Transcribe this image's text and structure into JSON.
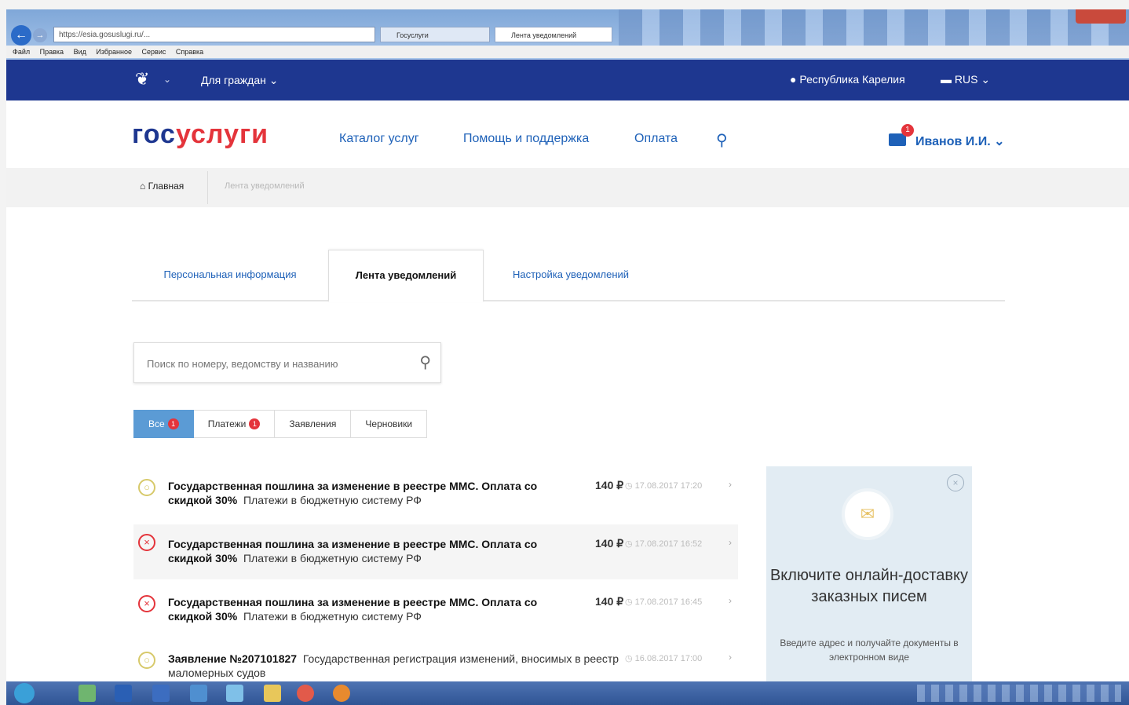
{
  "browser": {
    "address": "https://esia.gosuslugi.ru/...",
    "tabs": [
      "Госуслуги",
      "Лента уведомлений"
    ],
    "menu": [
      "Файл",
      "Правка",
      "Вид",
      "Избранное",
      "Сервис",
      "Справка"
    ]
  },
  "topbar": {
    "emblem_icon": "coat-of-arms-icon",
    "for_citizens": "Для граждан ⌄",
    "region": "Республика Карелия",
    "lang": "RUS ⌄"
  },
  "header": {
    "logo_part1": "гос",
    "logo_part2": "услуги",
    "nav": [
      "Каталог услуг",
      "Помощь и поддержка",
      "Оплата"
    ],
    "mail_badge": "1",
    "user": "Иванов И.И."
  },
  "breadcrumb": {
    "home": "Главная",
    "current": "Лента уведомлений"
  },
  "tabs": [
    {
      "label": "Персональная информация",
      "active": false
    },
    {
      "label": "Лента уведомлений",
      "active": true
    },
    {
      "label": "Настройка уведомлений",
      "active": false
    }
  ],
  "search": {
    "placeholder": "Поиск по номеру, ведомству и названию"
  },
  "filters": [
    {
      "label": "Все",
      "badge": "1",
      "active": true
    },
    {
      "label": "Платежи",
      "badge": "1",
      "active": false
    },
    {
      "label": "Заявления",
      "badge": "",
      "active": false
    },
    {
      "label": "Черновики",
      "badge": "",
      "active": false
    }
  ],
  "feed": [
    {
      "status": "pending",
      "title": "Государственная пошлина за изменение в реестре ММС. Оплата со скидкой 30%",
      "subtitle": "Платежи в бюджетную систему РФ",
      "amount": "140 ₽",
      "date": "17.08.2017 17:20"
    },
    {
      "status": "error",
      "title": "Государственная пошлина за изменение в реестре ММС. Оплата со скидкой 30%",
      "subtitle": "Платежи в бюджетную систему РФ",
      "amount": "140 ₽",
      "date": "17.08.2017 16:52"
    },
    {
      "status": "error",
      "title": "Государственная пошлина за изменение в реестре ММС. Оплата со скидкой 30%",
      "subtitle": "Платежи в бюджетную систему РФ",
      "amount": "140 ₽",
      "date": "17.08.2017 16:45"
    },
    {
      "status": "pending",
      "title": "Заявление №207101827",
      "subtitle": "Государственная регистрация изменений, вносимых в реестр маломерных судов",
      "amount": "",
      "date": "16.08.2017 17:00"
    }
  ],
  "promo": {
    "title": "Включите онлайн-доставку заказных писем",
    "text": "Введите адрес и получайте документы в электронном виде"
  },
  "colors": {
    "brand_blue": "#1e3790",
    "link_blue": "#1e61b8",
    "brand_red": "#e4343b",
    "filter_active": "#5b9bd5"
  }
}
